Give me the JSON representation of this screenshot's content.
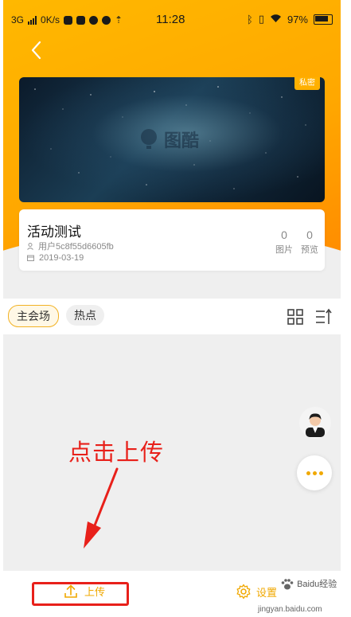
{
  "status_bar": {
    "network": "3G",
    "speed": "0K/s",
    "time": "11:28",
    "battery": "97%"
  },
  "event": {
    "badge": "私密",
    "watermark": "图酷",
    "title": "活动测试",
    "user": "用户5c8f55d6605fb",
    "date": "2019-03-19",
    "stats": [
      {
        "value": "0",
        "label": "图片"
      },
      {
        "value": "0",
        "label": "预览"
      }
    ]
  },
  "tabs": [
    {
      "label": "主会场",
      "active": true
    },
    {
      "label": "热点",
      "active": false
    }
  ],
  "annotation": {
    "text": "点击上传",
    "color": "#e8201a"
  },
  "bottom_bar": {
    "upload_label": "上传",
    "settings_label": "设置",
    "watermark_text": "Baidu经验",
    "watermark_url": "jingyan.baidu.com"
  },
  "colors": {
    "brand": "#ffb000",
    "accent": "#f0a800",
    "annotation": "#e8201a"
  }
}
